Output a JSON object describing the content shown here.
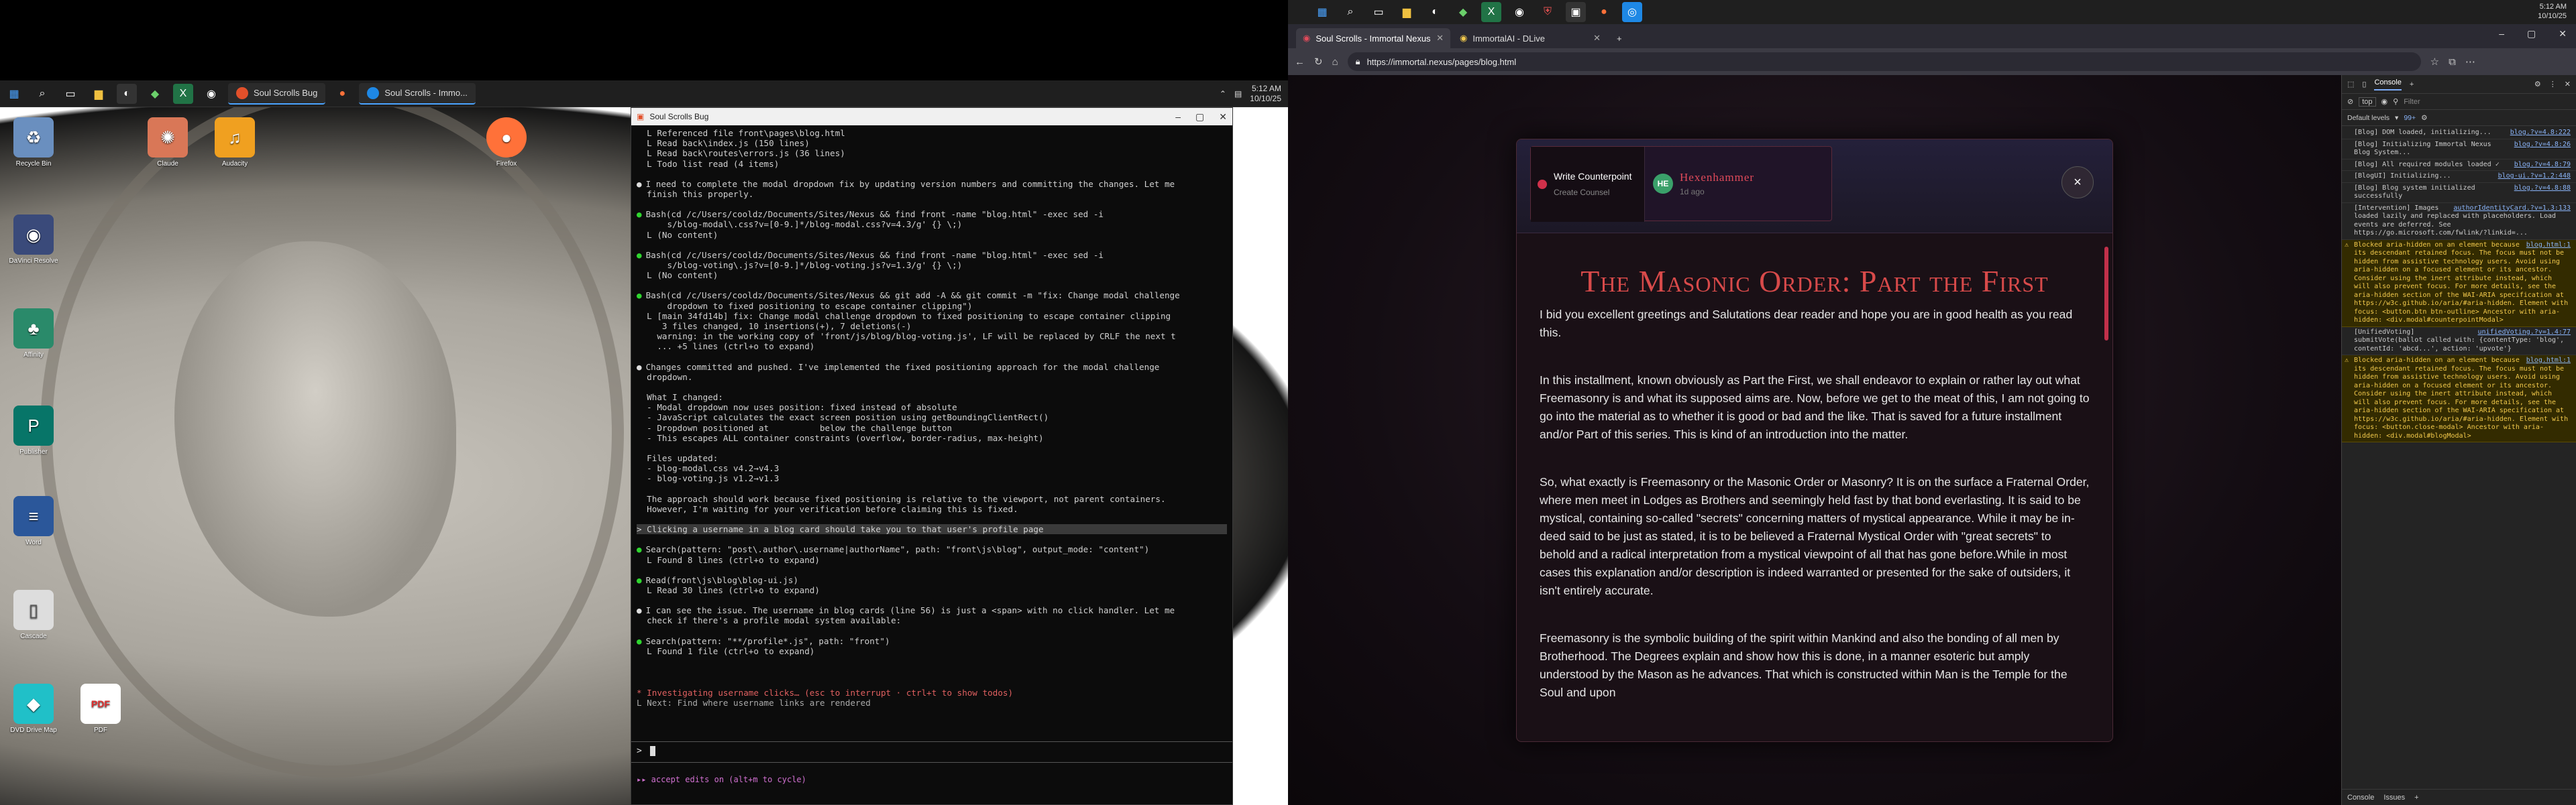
{
  "left_taskbar": {
    "apps": [
      {
        "label": "Soul Scrolls Bug",
        "color": "#e2502a"
      },
      {
        "label": "Soul Scrolls - Immo...",
        "color": "#1e88e5"
      }
    ],
    "clock": {
      "time": "5:12 AM",
      "date": "10/10/25"
    }
  },
  "desktop_icons": [
    {
      "label": "Recycle Bin",
      "icon": "recycle-bin-icon",
      "color": "#6a8fbf"
    },
    {
      "label": "DaVinci Resolve",
      "icon": "davinci-icon",
      "color": "#3a4a7a"
    },
    {
      "label": "Affinity",
      "icon": "tree-icon",
      "color": "#2a8a6a"
    },
    {
      "label": "Publisher",
      "icon": "publisher-icon",
      "color": "#077568"
    },
    {
      "label": "Word",
      "icon": "document-icon",
      "color": "#2b579a"
    },
    {
      "label": "Cascade",
      "icon": "file-icon",
      "color": "#dddddd"
    },
    {
      "label": "DVD Drive Map",
      "icon": "cube-icon",
      "color": "#20c0c8"
    },
    {
      "label": "Claude",
      "icon": "claude-icon",
      "color": "#d97757"
    },
    {
      "label": "PDF",
      "icon": "pdf-icon",
      "color": "#e03030"
    },
    {
      "label": "Audacity",
      "icon": "audacity-icon",
      "color": "#f0a020"
    },
    {
      "label": "Firefox",
      "icon": "firefox-icon",
      "color": "#ff7139"
    }
  ],
  "terminal": {
    "title": "Soul Scrolls Bug",
    "lines": [
      {
        "t": "  L Referenced file front\\pages\\blog.html",
        "k": ""
      },
      {
        "t": "  L Read back\\index.js (150 lines)",
        "k": ""
      },
      {
        "t": "  L Read back\\routes\\errors.js (36 lines)",
        "k": ""
      },
      {
        "t": "  L Todo list read (4 items)",
        "k": ""
      },
      {
        "t": "",
        "k": "gap"
      },
      {
        "t": "I need to complete the modal dropdown fix by updating version numbers and committing the changes. Let me",
        "k": "white"
      },
      {
        "t": "  finish this properly.",
        "k": ""
      },
      {
        "t": "",
        "k": "gap"
      },
      {
        "t": "Bash(cd /c/Users/cooldz/Documents/Sites/Nexus && find front -name \"blog.html\" -exec sed -i",
        "k": "bullet"
      },
      {
        "t": "      s/blog-modal\\.css?v=[0-9.]*/blog-modal.css?v=4.3/g' {} \\;)",
        "k": ""
      },
      {
        "t": "  L (No content)",
        "k": ""
      },
      {
        "t": "",
        "k": "gap"
      },
      {
        "t": "Bash(cd /c/Users/cooldz/Documents/Sites/Nexus && find front -name \"blog.html\" -exec sed -i",
        "k": "bullet"
      },
      {
        "t": "      s/blog-voting\\.js?v=[0-9.]*/blog-voting.js?v=1.3/g' {} \\;)",
        "k": ""
      },
      {
        "t": "  L (No content)",
        "k": ""
      },
      {
        "t": "",
        "k": "gap"
      },
      {
        "t": "Bash(cd /c/Users/cooldz/Documents/Sites/Nexus && git add -A && git commit -m \"fix: Change modal challenge",
        "k": "bullet"
      },
      {
        "t": "      dropdown to fixed positioning to escape container clipping\")",
        "k": ""
      },
      {
        "t": "  L [main 34fd14b] fix: Change modal challenge dropdown to fixed positioning to escape container clipping",
        "k": ""
      },
      {
        "t": "     3 files changed, 10 insertions(+), 7 deletions(-)",
        "k": ""
      },
      {
        "t": "    warning: in the working copy of 'front/js/blog/blog-voting.js', LF will be replaced by CRLF the next t",
        "k": ""
      },
      {
        "t": "    ... +5 lines (ctrl+o to expand)",
        "k": ""
      },
      {
        "t": "",
        "k": "gap"
      },
      {
        "t": "Changes committed and pushed. I've implemented the fixed positioning approach for the modal challenge",
        "k": "white"
      },
      {
        "t": "  dropdown.",
        "k": ""
      },
      {
        "t": "",
        "k": "gap"
      },
      {
        "t": "  What I changed:",
        "k": ""
      },
      {
        "t": "  - Modal dropdown now uses position: fixed instead of absolute",
        "k": ""
      },
      {
        "t": "  - JavaScript calculates the exact screen position using getBoundingClientRect()",
        "k": ""
      },
      {
        "t": "  - Dropdown positioned at          below the challenge button",
        "k": ""
      },
      {
        "t": "  - This escapes ALL container constraints (overflow, border-radius, max-height)",
        "k": ""
      },
      {
        "t": "",
        "k": "gap"
      },
      {
        "t": "  Files updated:",
        "k": ""
      },
      {
        "t": "  - blog-modal.css v4.2→v4.3",
        "k": ""
      },
      {
        "t": "  - blog-voting.js v1.2→v1.3",
        "k": ""
      },
      {
        "t": "",
        "k": "gap"
      },
      {
        "t": "  The approach should work because fixed positioning is relative to the viewport, not parent containers.",
        "k": ""
      },
      {
        "t": "  However, I'm waiting for your verification before claiming this is fixed.",
        "k": ""
      },
      {
        "t": "",
        "k": "gap"
      },
      {
        "t": "> Clicking a username in a blog card should take you to that user's profile page",
        "k": "hl"
      },
      {
        "t": "",
        "k": "gap"
      },
      {
        "t": "Search(pattern: \"post\\.author\\.username|authorName\", path: \"front\\js\\blog\", output_mode: \"content\")",
        "k": "bullet"
      },
      {
        "t": "  L Found 8 lines (ctrl+o to expand)",
        "k": ""
      },
      {
        "t": "",
        "k": "gap"
      },
      {
        "t": "Read(front\\js\\blog\\blog-ui.js)",
        "k": "bullet"
      },
      {
        "t": "  L Read 30 lines (ctrl+o to expand)",
        "k": ""
      },
      {
        "t": "",
        "k": "gap"
      },
      {
        "t": "I can see the issue. The username in blog cards (line 56) is just a <span> with no click handler. Let me",
        "k": "white"
      },
      {
        "t": "  check if there's a profile modal system available:",
        "k": ""
      },
      {
        "t": "",
        "k": "gap"
      },
      {
        "t": "Search(pattern: \"**/profile*.js\", path: \"front\")",
        "k": "bullet"
      },
      {
        "t": "  L Found 1 file (ctrl+o to expand)",
        "k": ""
      }
    ],
    "status": "* Investigating username clicks… (esc to interrupt · ctrl+t to show todos)",
    "status_next": "  L Next: Find where username links are rendered",
    "prompt": ">",
    "footer": "▸▸ accept edits on (alt+m to cycle)"
  },
  "right_taskbar": {
    "time": "5:12 AM",
    "date": "10/10/25"
  },
  "browser": {
    "tabs": [
      {
        "label": "Soul Scrolls - Immortal Nexus",
        "color": "#e04a5a"
      },
      {
        "label": "ImmortalAI - DLive",
        "color": "#f2c94c"
      }
    ],
    "url": "https://immortal.nexus/pages/blog.html"
  },
  "modal": {
    "counterpoint_label": "Write Counterpoint",
    "counterpoint_sub": "Create Counsel",
    "author_initials": "HE",
    "author_name": "Hexenhammer",
    "author_time": "1d ago",
    "close_symbol": "×",
    "title": "The Masonic Order: Part the First",
    "paragraphs": [
      "I bid you excellent greetings and Salutations dear reader and hope you are in good health as you read this.",
      "In this installment, known obviously as Part the First, we shall endeavor to explain or rather lay out what Freemasonry is and what its supposed aims are. Now, before we get to the meat of this, I am not going to go into the material as to whether it is good or bad and the like. That is saved for a future installment and/or Part of this series. This is kind of an introduction into the matter.",
      "So, what exactly is Freemasonry or the Masonic Order or Masonry? It is on the surface a Fraternal Order, where men meet in Lodges as Brothers and seemingly held fast by that bond everlasting. It is said to be mystical, containing so-called \"secrets\" concerning matters of mystical appearance. While it may be in-deed said to be just as stated, it is to be believed a Fraternal Mystical Order with \"great secrets\" to behold and a radical interpretation from a mystical viewpoint of all that has gone before.While in most cases this explanation and/or description is indeed warranted or presented for the sake of outsiders, it isn't entirely accurate.",
      "Freemasonry is the symbolic building of the spirit within Mankind and also the bonding of all men by Brotherhood. The Degrees explain and show how this is done, in a manner esoteric but amply understood by the Mason as he advances. That which is constructed within Man is the Temple for the Soul and upon"
    ]
  },
  "devtools": {
    "tabs": [
      "Console"
    ],
    "filter_placeholder": "Filter",
    "context": "top",
    "levels": "Default levels",
    "issues": "99+",
    "logs": [
      {
        "text": "[Blog] DOM loaded, initializing...",
        "src": "blog.?v=4.8:222",
        "warn": false
      },
      {
        "text": "[Blog] Initializing Immortal Nexus Blog System...",
        "src": "blog.?v=4.8:26",
        "warn": false
      },
      {
        "text": "[Blog] All required modules loaded ✓",
        "src": "blog.?v=4.8:79",
        "warn": false
      },
      {
        "text": "[BlogUI] Initializing...",
        "src": "blog-ui.?v=1.2:448",
        "warn": false
      },
      {
        "text": "[Blog] Blog system initialized successfully",
        "src": "blog.?v=4.8:88",
        "warn": false
      },
      {
        "text": "[Intervention] Images loaded lazily and replaced with placeholders. Load events are deferred. See https://go.microsoft.com/fwlink/?linkid=...",
        "src": "authorIdentityCard.?v=1.3:133",
        "warn": false
      },
      {
        "text": "Blocked aria-hidden on an element because its descendant retained focus. The focus must not be hidden from assistive technology users. Avoid using aria-hidden on a focused element or its ancestor. Consider using the inert attribute instead, which will also prevent focus. For more details, see the aria-hidden section of the WAI-ARIA specification at https://w3c.github.io/aria/#aria-hidden. Element with focus: <button.btn btn-outline> Ancestor with aria-hidden: <div.modal#counterpointModal>",
        "src": "blog.html:1",
        "warn": true
      },
      {
        "text": "[UnifiedVoting] submitVote(ballot called with: {contentType: 'blog', contentId: 'abcd...', action: 'upvote'}",
        "src": "unifiedVoting.?v=1.4:77",
        "warn": false
      },
      {
        "text": "Blocked aria-hidden on an element because its descendant retained focus. The focus must not be hidden from assistive technology users. Avoid using aria-hidden on a focused element or its ancestor. Consider using the inert attribute instead, which will also prevent focus. For more details, see the aria-hidden section of the WAI-ARIA specification at https://w3c.github.io/aria/#aria-hidden. Element with focus: <button.close-modal> Ancestor with aria-hidden: <div.modal#blogModal>",
        "src": "blog.html:1",
        "warn": true
      }
    ],
    "bottom_tabs": [
      "Console",
      "Issues"
    ]
  }
}
